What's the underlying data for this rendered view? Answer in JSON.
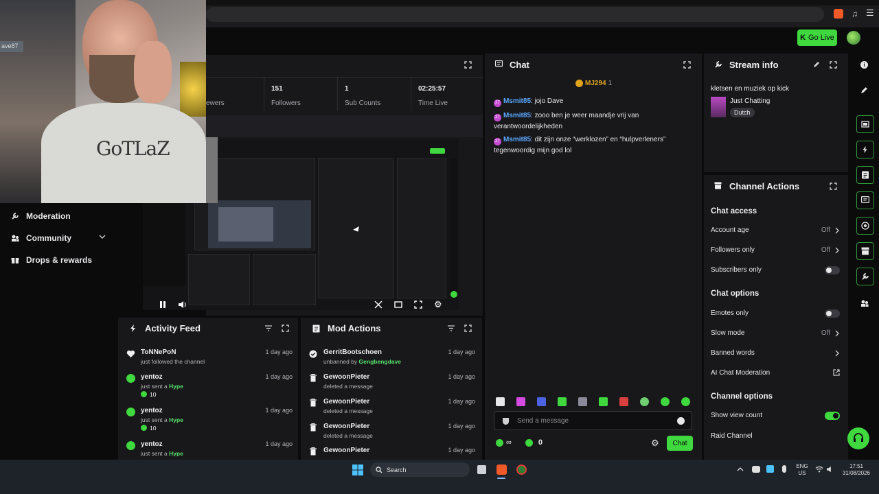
{
  "header": {
    "go_live_label": "Go Live"
  },
  "webcam": {
    "name_tag": "ave87",
    "shirt_logo": "GoTLaZ"
  },
  "stats": [
    {
      "value": "",
      "label": "ewers"
    },
    {
      "value": "151",
      "label": "Followers"
    },
    {
      "value": "1",
      "label": "Sub Counts"
    },
    {
      "value": "02:25:57",
      "label": "Time Live"
    }
  ],
  "sidebar": {
    "items": [
      {
        "label": "Moderation",
        "icon": "wrench-icon"
      },
      {
        "label": "Community",
        "icon": "community-icon"
      },
      {
        "label": "Drops & rewards",
        "icon": "gift-icon"
      }
    ]
  },
  "activity": {
    "title": "Activity Feed",
    "rows": [
      {
        "name": "ToNNePoN",
        "sub": "just followed the channel",
        "time": "1 day ago",
        "icon": "heart-icon"
      },
      {
        "name": "yentoz",
        "sub_prefix": "just sent a",
        "sub_highlight": "Hype",
        "amount": "10",
        "time": "1 day ago",
        "icon": "kick-coin-icon"
      },
      {
        "name": "yentoz",
        "sub_prefix": "just sent a",
        "sub_highlight": "Hype",
        "amount": "10",
        "time": "1 day ago",
        "icon": "kick-coin-icon"
      },
      {
        "name": "yentoz",
        "sub_prefix": "just sent a",
        "sub_highlight": "Hype",
        "time": "1 day ago",
        "icon": "kick-coin-icon"
      }
    ]
  },
  "mod_actions": {
    "title": "Mod Actions",
    "rows": [
      {
        "name": "GerritBootschoen",
        "sub_prefix": "unbanned by",
        "sub_highlight": "Gengbengdave",
        "time": "1 day ago"
      },
      {
        "name": "GewoonPieter",
        "sub": "deleted a message",
        "time": "1 day ago"
      },
      {
        "name": "GewoonPieter",
        "sub": "deleted a message",
        "time": "1 day ago"
      },
      {
        "name": "GewoonPieter",
        "sub": "deleted a message",
        "time": "1 day ago"
      },
      {
        "name": "GewoonPieter",
        "time": "1 day ago"
      }
    ]
  },
  "chat": {
    "title": "Chat",
    "pinned_user": "MJ294",
    "pinned_count": "1",
    "messages": [
      {
        "badge": "27",
        "user": "Msmit85",
        "text": "jojo Dave"
      },
      {
        "badge": "27",
        "user": "Msmit85",
        "text": "zooo ben je weer maandje vrij van verantwoordelijkheden"
      },
      {
        "badge": "27",
        "user": "Msmit85",
        "text": "dit zijn onze “werklozen” en “hulpverleners” tegenwoordig mijn god lol"
      }
    ],
    "input_placeholder": "Send a message",
    "infinite_symbol": "∞",
    "points": "0",
    "send_label": "Chat"
  },
  "stream_info": {
    "title": "Stream info",
    "stream_title": "kletsen en muziek op kick",
    "category": "Just Chatting",
    "language_tag": "Dutch"
  },
  "channel_actions": {
    "title": "Channel Actions",
    "chat_access_heading": "Chat access",
    "account_age_label": "Account age",
    "account_age_value": "Off",
    "followers_only_label": "Followers only",
    "followers_only_value": "Off",
    "subscribers_only_label": "Subscribers only",
    "subscribers_only_on": false,
    "chat_options_heading": "Chat options",
    "emotes_only_label": "Emotes only",
    "emotes_only_on": false,
    "slow_mode_label": "Slow mode",
    "slow_mode_value": "Off",
    "banned_words_label": "Banned words",
    "ai_moderation_label": "AI Chat Moderation",
    "channel_options_heading": "Channel options",
    "show_view_count_label": "Show view count",
    "show_view_count_on": true,
    "raid_channel_label": "Raid Channel"
  },
  "taskbar": {
    "search_label": "Search",
    "lang_line1": "ENG",
    "lang_line2": "US",
    "time": "17:51",
    "date": "31/08/2026"
  },
  "colors": {
    "accent": "#3fd83f",
    "panel": "#18181b",
    "username": "#5aa8ff"
  }
}
